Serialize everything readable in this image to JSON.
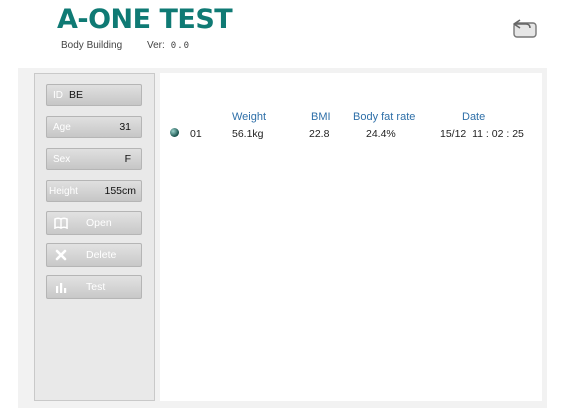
{
  "header": {
    "logo_text": "A-ONE TEST",
    "subtitle": "Body Building",
    "version_label": "Ver:",
    "version_value": "0.0",
    "back_icon": "back-return-icon"
  },
  "sidebar": {
    "fields": [
      {
        "label": "ID",
        "value": "BE"
      },
      {
        "label": "Age",
        "value": "31"
      },
      {
        "label": "Sex",
        "value": "F"
      },
      {
        "label": "Height",
        "value": "155cm"
      }
    ],
    "buttons": [
      {
        "label": "Open",
        "icon": "open-book-icon"
      },
      {
        "label": "Delete",
        "icon": "delete-x-icon"
      },
      {
        "label": "Test",
        "icon": "bar-chart-icon"
      }
    ]
  },
  "records": {
    "columns": [
      "Weight",
      "BMI",
      "Body fat rate",
      "Date"
    ],
    "rows": [
      {
        "index": "01",
        "weight": "56.1kg",
        "bmi": "22.8",
        "body_fat": "24.4%",
        "date": "15/12  11 : 02 : 25"
      }
    ]
  },
  "colors": {
    "logo": "#0f7a74",
    "column_header": "#2e6fa8",
    "button_gradient_top": "#e2e2e2",
    "button_gradient_bottom": "#c8c8c8"
  }
}
